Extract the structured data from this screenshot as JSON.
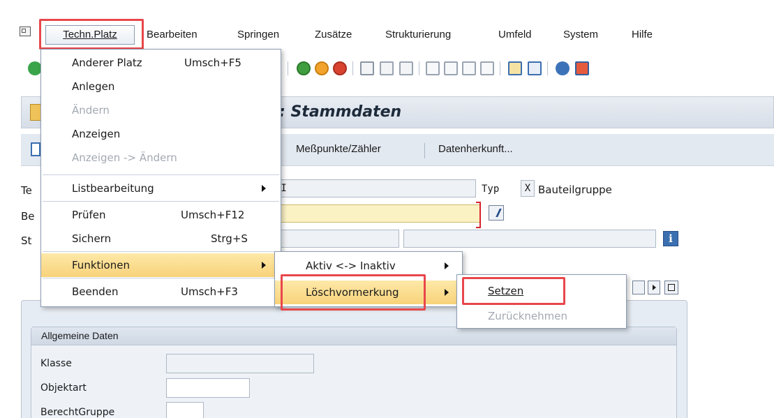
{
  "menubar": {
    "items": [
      "Techn.Platz",
      "Bearbeiten",
      "Springen",
      "Zusätze",
      "Strukturierung",
      "Umfeld",
      "System",
      "Hilfe"
    ]
  },
  "title": {
    "text": ": Stammdaten"
  },
  "app_toolbar": {
    "buttons": [
      "Meßpunkte/Zähler",
      "Datenherkunft..."
    ]
  },
  "form": {
    "row1": {
      "label": "Te",
      "value": "/I",
      "typ_label": "Typ",
      "typ_value": "X",
      "typ_text": "Bauteilgruppe"
    },
    "row2": {
      "label": "Be",
      "value": "e"
    },
    "row3": {
      "label": "St"
    }
  },
  "group": {
    "title": "Allgemeine Daten",
    "fields": [
      {
        "label": "Klasse"
      },
      {
        "label": "Objektart"
      },
      {
        "label": "BerechtGruppe"
      }
    ]
  },
  "menu_techn": {
    "items": [
      {
        "label": "Anderer Platz",
        "shortcut": "Umsch+F5",
        "enabled": true
      },
      {
        "label": "Anlegen",
        "shortcut": "",
        "enabled": true
      },
      {
        "label": "Ändern",
        "shortcut": "",
        "enabled": false
      },
      {
        "label": "Anzeigen",
        "shortcut": "",
        "enabled": true
      },
      {
        "label": "Anzeigen -> Ändern",
        "shortcut": "",
        "enabled": false
      },
      {
        "label": "Listbearbeitung",
        "shortcut": "",
        "enabled": true,
        "submenu": true
      },
      {
        "label": "Prüfen",
        "shortcut": "Umsch+F12",
        "enabled": true
      },
      {
        "label": "Sichern",
        "shortcut": "Strg+S",
        "enabled": true
      },
      {
        "label": "Funktionen",
        "shortcut": "",
        "enabled": true,
        "submenu": true,
        "highlighted": true
      },
      {
        "label": "Beenden",
        "shortcut": "Umsch+F3",
        "enabled": true
      }
    ]
  },
  "menu_funktionen": {
    "items": [
      {
        "label": "Aktiv <-> Inaktiv",
        "submenu": true
      },
      {
        "label": "Löschvormerkung",
        "submenu": true,
        "highlighted": true
      }
    ]
  },
  "menu_loeschvormerkung": {
    "items": [
      {
        "label": "Setzen",
        "enabled": true
      },
      {
        "label": "Zurücknehmen",
        "enabled": false
      }
    ]
  },
  "colors": {
    "highlight_outline": "#e8474c",
    "menu_hover": "#f8d27a",
    "title_bg": "#d7dee8"
  }
}
